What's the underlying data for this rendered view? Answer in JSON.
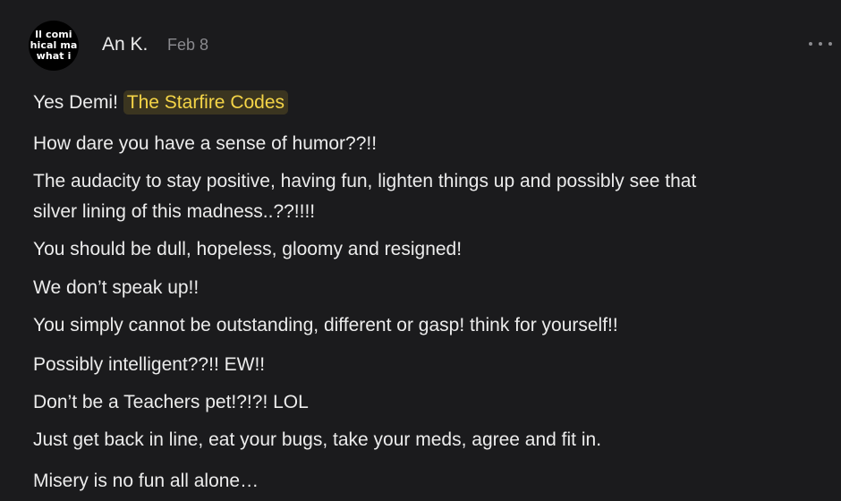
{
  "comment": {
    "avatar": {
      "text_lines": [
        "ll comi",
        "hical ma",
        "what i"
      ]
    },
    "author": "An K.",
    "date": "Feb 8",
    "greeting": "Yes Demi!",
    "mention": "The Starfire Codes",
    "lines": [
      "How dare you have a sense of humor??!!",
      "The audacity to stay positive, having fun, lighten things up and possibly see that",
      "silver lining of this madness..??!!!!",
      "You should be dull, hopeless, gloomy and resigned!",
      "We don’t speak up!!",
      "You simply cannot be outstanding, different or gasp! think for yourself!!",
      "Possibly intelligent??!! EW!!",
      "Don’t be a Teachers pet!?!?! LOL",
      "Just get back in line, eat your bugs, take your meds, agree and fit in.",
      "Misery is no fun all alone…"
    ]
  },
  "colors": {
    "background": "#1b1b1d",
    "text": "#ececec",
    "muted": "#8a8a8e",
    "mention_text": "#f5d547",
    "mention_bg": "#3b3520"
  },
  "icons": {
    "more_menu": "ellipsis-horizontal-icon"
  }
}
